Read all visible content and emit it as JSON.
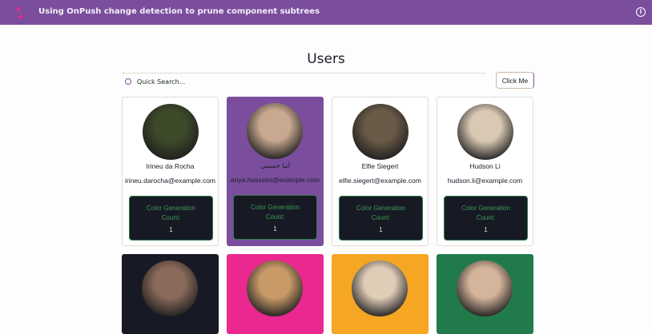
{
  "header": {
    "title": "Using OnPush change detection to prune component subtrees",
    "info_icon": "i"
  },
  "page_title": "Users",
  "search": {
    "placeholder": "Quick Search..."
  },
  "button_label": "Click Me",
  "counter_label": "Color Generation Count:",
  "cards": [
    {
      "name": "Irineu da Rocha",
      "email": "irineu.darocha@example.com",
      "count": "1",
      "bg": "#ffffff",
      "photo": "#3d4a2a"
    },
    {
      "name": "آنیا حسینی",
      "email": "anya.hosseini@example.com",
      "count": "1",
      "bg": "#7b4e9d",
      "photo": "#c8a890"
    },
    {
      "name": "Elfie Siegert",
      "email": "elfie.siegert@example.com",
      "count": "1",
      "bg": "#ffffff",
      "photo": "#6a5a48"
    },
    {
      "name": "Hudson Li",
      "email": "hudson.li@example.com",
      "count": "1",
      "bg": "#ffffff",
      "photo": "#d8c8b4"
    },
    {
      "bg": "#171a24",
      "photo": "#8a6a5a"
    },
    {
      "bg": "#ea288f",
      "photo": "#c89a68"
    },
    {
      "bg": "#f5a623",
      "photo": "#e0cdb8"
    },
    {
      "bg": "#217a4a",
      "photo": "#d4b49a"
    }
  ]
}
